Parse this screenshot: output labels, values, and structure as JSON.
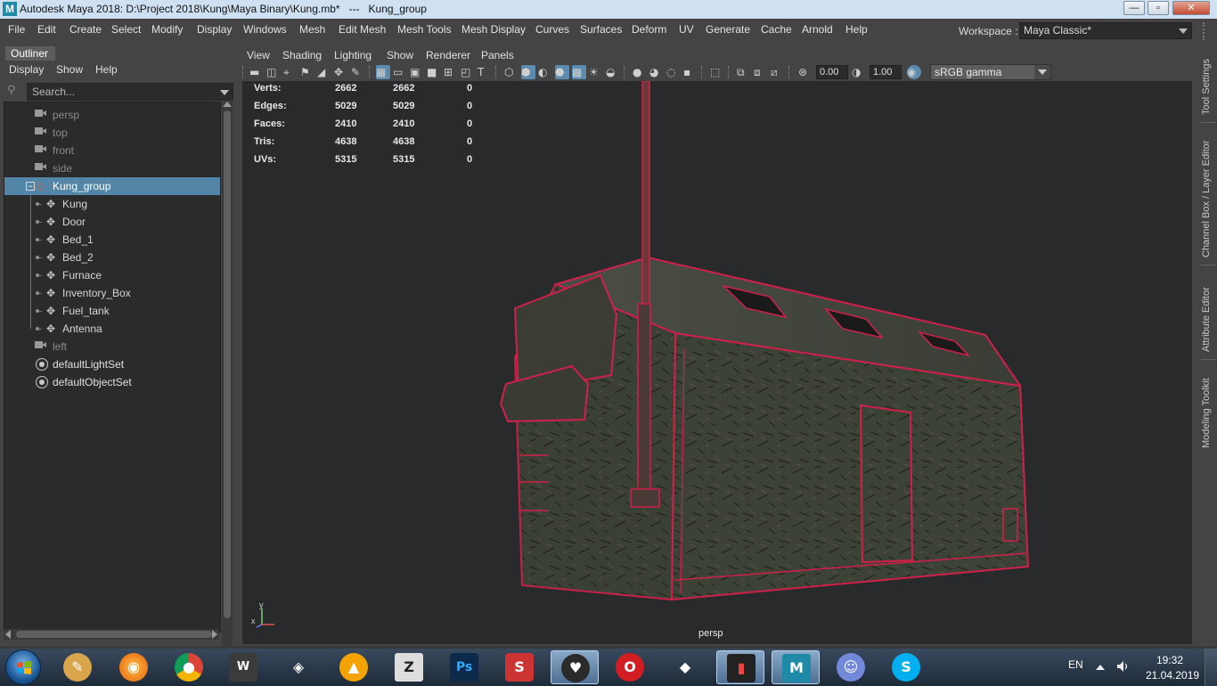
{
  "window": {
    "title": "Autodesk Maya 2018: D:\\Project 2018\\Kung\\Maya Binary\\Kung.mb*   ---   Kung_group",
    "app_icon_letter": "M",
    "minimize": "—",
    "maximize": "▫",
    "close": "✕"
  },
  "menubar": {
    "items": [
      "File",
      "Edit",
      "Create",
      "Select",
      "Modify",
      "Display",
      "Windows",
      "Mesh",
      "Edit Mesh",
      "Mesh Tools",
      "Mesh Display",
      "Curves",
      "Surfaces",
      "Deform",
      "UV",
      "Generate",
      "Cache",
      "Arnold",
      "Help"
    ],
    "workspace_label": "Workspace :",
    "workspace_value": "Maya Classic*"
  },
  "outliner": {
    "tab": "Outliner",
    "menu": [
      "Display",
      "Show",
      "Help"
    ],
    "search_placeholder": "Search...",
    "cameras_top": [
      "persp",
      "top",
      "front",
      "side"
    ],
    "group": "Kung_group",
    "children": [
      "Kung",
      "Door",
      "Bed_1",
      "Bed_2",
      "Furnace",
      "Inventory_Box",
      "Fuel_tank",
      "Antenna"
    ],
    "camera_bottom": "left",
    "sets": [
      "defaultLightSet",
      "defaultObjectSet"
    ]
  },
  "viewport": {
    "menu": [
      "View",
      "Shading",
      "Lighting",
      "Show",
      "Renderer",
      "Panels"
    ],
    "exposure": "0.00",
    "gamma": "1.00",
    "color_space": "sRGB gamma",
    "camera": "persp",
    "hud": {
      "rows": [
        {
          "label": "Verts:",
          "a": "2662",
          "b": "2662",
          "c": "0"
        },
        {
          "label": "Edges:",
          "a": "5029",
          "b": "5029",
          "c": "0"
        },
        {
          "label": "Faces:",
          "a": "2410",
          "b": "2410",
          "c": "0"
        },
        {
          "label": "Tris:",
          "a": "4638",
          "b": "4638",
          "c": "0"
        },
        {
          "label": "UVs:",
          "a": "5315",
          "b": "5315",
          "c": "0"
        }
      ]
    },
    "axis_y": "y",
    "axis_x": "x"
  },
  "right_shelf": {
    "tabs": [
      "Tool Settings",
      "Channel Box / Layer Editor",
      "Attribute Editor",
      "Modeling Toolkit"
    ]
  },
  "taskbar": {
    "apps": [
      "paint",
      "firefox",
      "chrome",
      "world-of-tanks",
      "epic",
      "arc",
      "zbrush",
      "photoshop",
      "substance-painter",
      "headphones-app",
      "opera",
      "unity",
      "audio-app",
      "maya",
      "discord",
      "skype"
    ],
    "lang": "EN",
    "time": "19:32",
    "date": "21.04.2019"
  },
  "colors": {
    "selection": "#5285a6",
    "wire": "#d0204a",
    "viewport_bg": "#292a2c"
  }
}
